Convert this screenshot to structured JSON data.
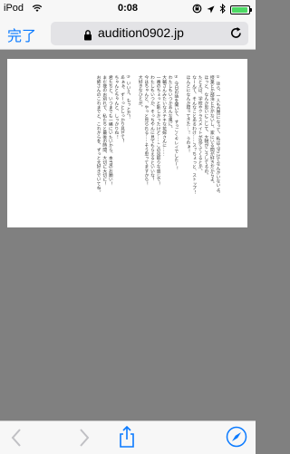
{
  "status_bar": {
    "carrier": "iPod",
    "time": "0:08",
    "battery_level": 0.95,
    "battery_color": "#4cd964"
  },
  "nav": {
    "done_label": "完了",
    "url": "audition0902.jp",
    "lock_icon": "lock-icon",
    "reload_icon": "reload-icon"
  },
  "document": {
    "text": "① ほら、一人も自然になって、私はふざけてなんかいないよ。\n授業とか部活とかがないし、家にいる間が好きだからよ。\nほっと、なんか思いにこして、大物がこうしてるの。\nたとえば、学校やクラスメイトが見ててくるとか。\nなーんて、そんなことあるわけ……ス？ちょっと、ストップ！\nほんとになんか寝ってきた…！ うわぁ！\n\n② 今日の話を聞いて、すっごくキレイでしたー！\nわたしもいつかあんな風に。\n大輔さんみたいなステキな花嫁さんに……\n一番のちょっと恥しかったけど……この見取りな感じで！\nわたしもいつか、そっちやんに見てもらえるといいな！\n今はちゃんと、やっと見られる……そう思ってますから！\n大好きなひとが。\n\n③ いいえ、もっとだ！\nあぁぁ、ずーっとしっかり見せて！\nちゃんとちゃんと、しっかりね！\n君たちと、いつまでも一緒にいたいから、本当のお願い！\nまだ夜のお別れで、私たちと最後の時間、大切に大切に！\nお姉さんのこれまでと、これからを、ずっと大好きでいてね。",
    "overflow": ""
  },
  "toolbar": {
    "back_icon": "back-icon",
    "forward_icon": "forward-icon",
    "share_icon": "share-icon",
    "compass_icon": "compass-icon",
    "accent_color": "#0a7aff",
    "disabled_color": "#c0c0c4"
  }
}
